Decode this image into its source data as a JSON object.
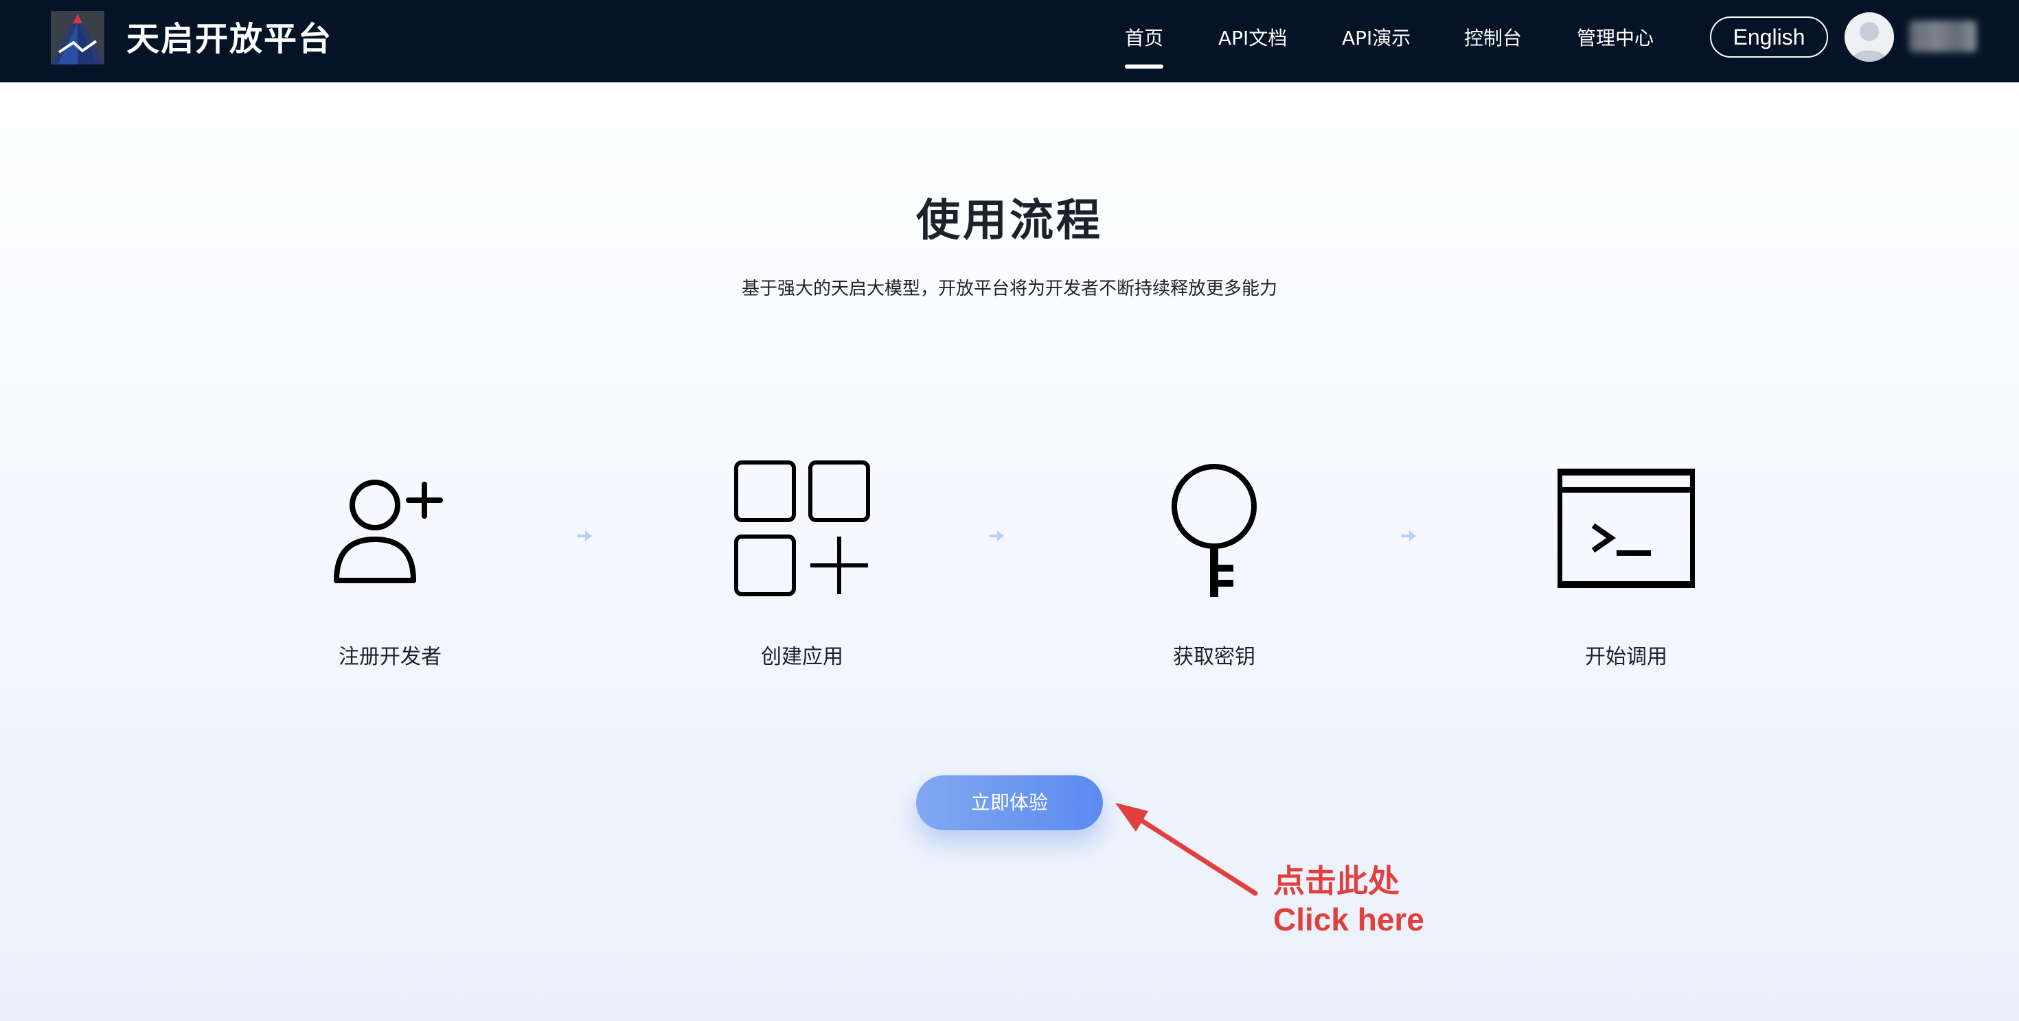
{
  "header": {
    "brand": "天启开放平台",
    "nav": [
      "首页",
      "API文档",
      "API演示",
      "控制台",
      "管理中心"
    ],
    "active_nav": "首页",
    "language_button": "English"
  },
  "main": {
    "title": "使用流程",
    "subtitle": "基于强大的天启大模型，开放平台将为开发者不断持续释放更多能力",
    "steps": [
      {
        "label": "注册开发者",
        "icon": "add-user-icon"
      },
      {
        "label": "创建应用",
        "icon": "apps-add-icon"
      },
      {
        "label": "获取密钥",
        "icon": "key-icon"
      },
      {
        "label": "开始调用",
        "icon": "terminal-icon"
      }
    ],
    "cta_label": "立即体验"
  },
  "annotation": {
    "line1": "点击此处",
    "line2": "Click here",
    "color": "#e0403e"
  },
  "colors": {
    "header_bg": "#061326",
    "cta_start": "#82a8f1",
    "cta_end": "#5b8af0",
    "step_arrow": "#bcd0f2"
  }
}
